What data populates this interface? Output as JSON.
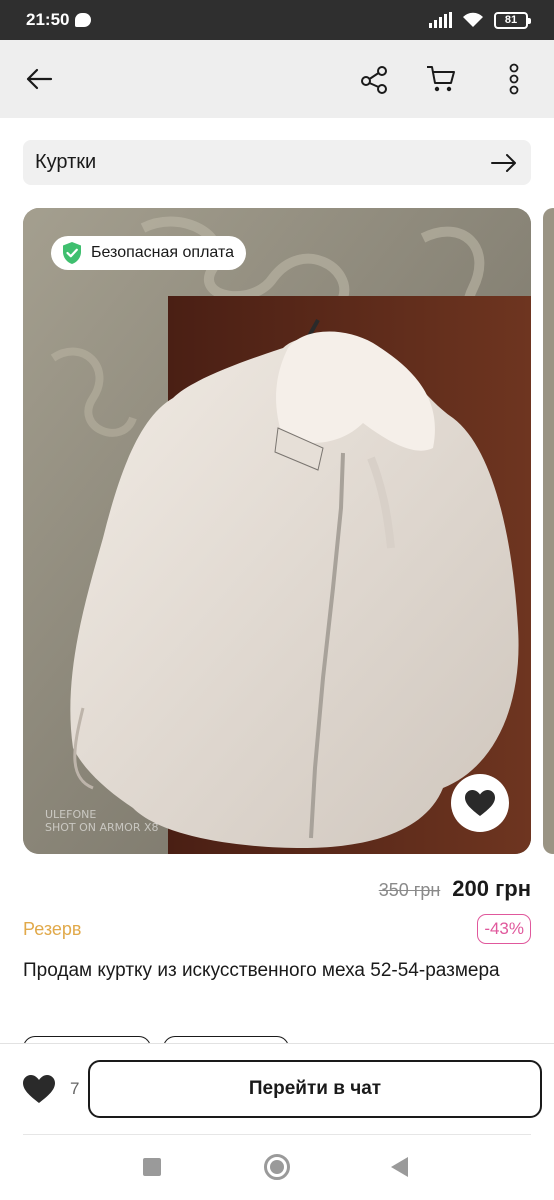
{
  "status_bar": {
    "time": "21:50",
    "battery": "81"
  },
  "header": {
    "back_icon": "arrow-left-icon",
    "share_icon": "share-icon",
    "cart_icon": "cart-icon",
    "more_icon": "more-vertical-icon"
  },
  "category": {
    "label": "Куртки",
    "arrow_icon": "arrow-right-icon"
  },
  "listing": {
    "safe_payment": "Безопасная оплата",
    "watermark_line1": "ULEFONE",
    "watermark_line2": "SHOT ON ARMOR X8",
    "old_price": "350 грн",
    "price": "200 грн",
    "status": "Резерв",
    "discount": "-43%",
    "title": "Продам куртку из искусственного меха 52-54-размера"
  },
  "actions": {
    "like_count": "7",
    "chat_button": "Перейти в чат"
  },
  "colors": {
    "accent_pink": "#e0589c",
    "reserve": "#e1a94a",
    "safe_green": "#3fbf6f"
  }
}
